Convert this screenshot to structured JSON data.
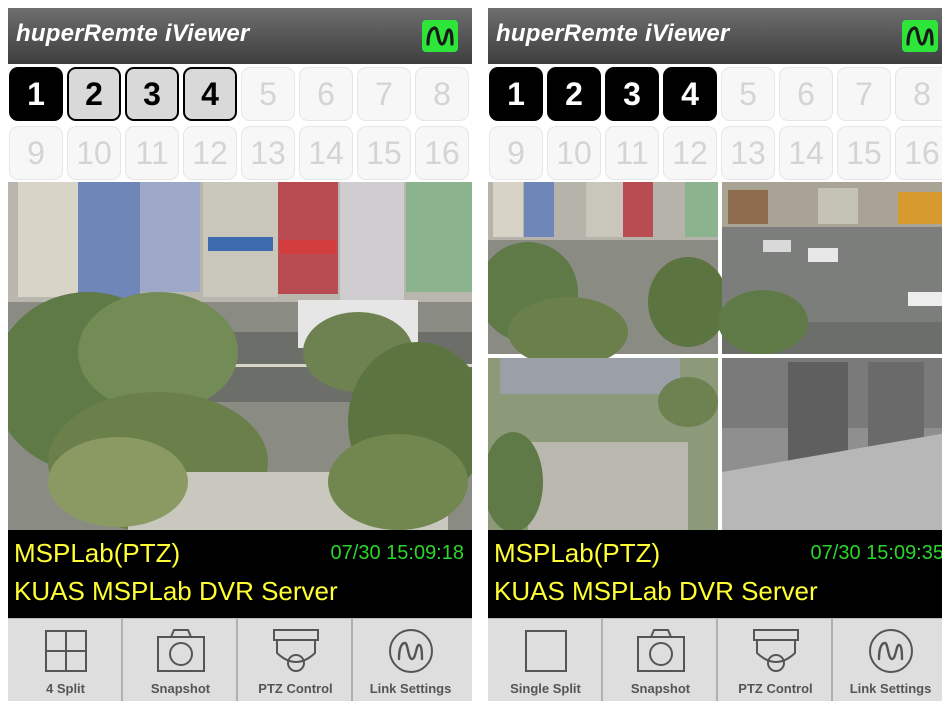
{
  "screens": [
    {
      "app_title": "huperRemte iViewer",
      "channels": [
        "1",
        "2",
        "3",
        "4",
        "5",
        "6",
        "7",
        "8",
        "9",
        "10",
        "11",
        "12",
        "13",
        "14",
        "15",
        "16"
      ],
      "camera_name": "MSPLab(PTZ)",
      "timestamp": "07/30 15:09:18",
      "server_name": "KUAS MSPLab DVR Server",
      "toolbar": {
        "split": "4 Split",
        "snapshot": "Snapshot",
        "ptz": "PTZ Control",
        "link": "Link Settings"
      }
    },
    {
      "app_title": "huperRemte iViewer",
      "channels": [
        "1",
        "2",
        "3",
        "4",
        "5",
        "6",
        "7",
        "8",
        "9",
        "10",
        "11",
        "12",
        "13",
        "14",
        "15",
        "16"
      ],
      "camera_name": "MSPLab(PTZ)",
      "timestamp": "07/30 15:09:35",
      "server_name": "KUAS MSPLab DVR Server",
      "toolbar": {
        "split": "Single Split",
        "snapshot": "Snapshot",
        "ptz": "PTZ Control",
        "link": "Link Settings"
      }
    }
  ],
  "colors": {
    "title_bar": "#4e4e4e",
    "connect_icon": "#2ee63a",
    "camera_text": "#ffff33",
    "time_text": "#2bd62b"
  }
}
